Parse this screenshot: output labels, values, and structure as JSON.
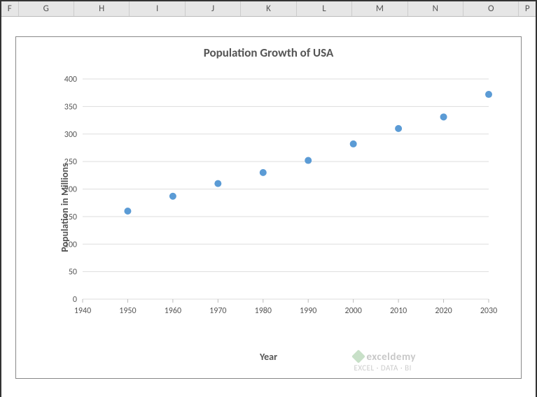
{
  "columns": [
    "F",
    "G",
    "H",
    "I",
    "J",
    "K",
    "L",
    "M",
    "N",
    "O",
    "P"
  ],
  "chart_data": {
    "type": "scatter",
    "title": "Population Growth of USA",
    "xlabel": "Year",
    "ylabel": "Population in Millions",
    "x": [
      1950,
      1960,
      1970,
      1980,
      1990,
      2000,
      2010,
      2020,
      2030
    ],
    "y": [
      160,
      187,
      210,
      230,
      252,
      282,
      310,
      331,
      372
    ],
    "xlim": [
      1940,
      2030
    ],
    "ylim": [
      0,
      400
    ],
    "xticks": [
      1940,
      1950,
      1960,
      1970,
      1980,
      1990,
      2000,
      2010,
      2020,
      2030
    ],
    "yticks": [
      0,
      50,
      100,
      150,
      200,
      250,
      300,
      350,
      400
    ],
    "point_color": "#5b9bd5"
  },
  "watermark": {
    "brand": "exceldemy",
    "tagline": "EXCEL · DATA · BI"
  }
}
